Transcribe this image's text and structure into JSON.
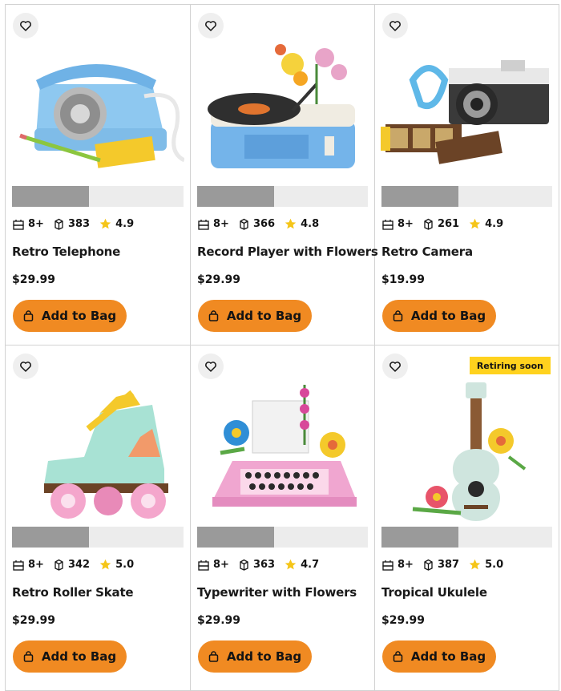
{
  "products": [
    {
      "title": "Retro Telephone",
      "age": "8+",
      "pieces": "383",
      "rating": "4.9",
      "price": "$29.99",
      "button": "Add to Bag",
      "badge": "",
      "image_progress": 0.45
    },
    {
      "title": "Record Player with Flowers",
      "age": "8+",
      "pieces": "366",
      "rating": "4.8",
      "price": "$29.99",
      "button": "Add to Bag",
      "badge": "",
      "image_progress": 0.45
    },
    {
      "title": "Retro Camera",
      "age": "8+",
      "pieces": "261",
      "rating": "4.9",
      "price": "$19.99",
      "button": "Add to Bag",
      "badge": "",
      "image_progress": 0.45
    },
    {
      "title": "Retro Roller Skate",
      "age": "8+",
      "pieces": "342",
      "rating": "5.0",
      "price": "$29.99",
      "button": "Add to Bag",
      "badge": "",
      "image_progress": 0.45
    },
    {
      "title": "Typewriter with Flowers",
      "age": "8+",
      "pieces": "363",
      "rating": "4.7",
      "price": "$29.99",
      "button": "Add to Bag",
      "badge": "",
      "image_progress": 0.45
    },
    {
      "title": "Tropical Ukulele",
      "age": "8+",
      "pieces": "387",
      "rating": "5.0",
      "price": "$29.99",
      "button": "Add to Bag",
      "badge": "Retiring soon",
      "image_progress": 0.45
    }
  ],
  "icons": {
    "wishlist": "heart-icon",
    "age": "age-blocks-icon",
    "pieces": "brick-icon",
    "rating": "star-icon",
    "bag": "shopping-bag-icon"
  },
  "colors": {
    "button": "#f08a22",
    "star": "#f5c518",
    "badge": "#ffd21e",
    "bar_fill": "#9a9a9a",
    "bar_track": "#ececec"
  }
}
